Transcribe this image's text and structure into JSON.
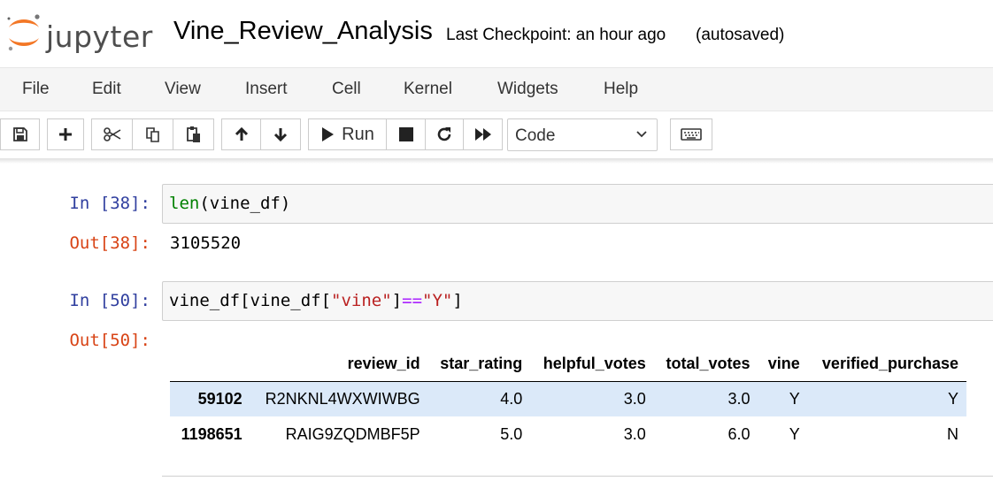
{
  "header": {
    "logo_text": "jupyter",
    "notebook_title": "Vine_Review_Analysis",
    "checkpoint": "Last Checkpoint: an hour ago",
    "autosave": "(autosaved)"
  },
  "menu": [
    "File",
    "Edit",
    "View",
    "Insert",
    "Cell",
    "Kernel",
    "Widgets",
    "Help"
  ],
  "toolbar": {
    "run_label": "Run",
    "cell_type": "Code",
    "icons": [
      "save-icon",
      "plus-icon",
      "cut-icon",
      "copy-icon",
      "paste-icon",
      "arrow-up-icon",
      "arrow-down-icon",
      "run-icon",
      "stop-icon",
      "restart-icon",
      "fast-forward-icon",
      "keyboard-icon"
    ]
  },
  "cells": [
    {
      "in_prompt": "In [38]:",
      "code": {
        "fn": "len",
        "rest": "(vine_df)"
      },
      "out_prompt": "Out[38]:",
      "output": "3105520"
    },
    {
      "in_prompt": "In [50]:",
      "code": {
        "p1": "vine_df[vine_df[",
        "s1": "\"vine\"",
        "p2": "]",
        "op": "==",
        "s2": "\"Y\"",
        "p3": "]"
      },
      "out_prompt": "Out[50]:"
    }
  ],
  "dataframe": {
    "columns": [
      "",
      "review_id",
      "star_rating",
      "helpful_votes",
      "total_votes",
      "vine",
      "verified_purchase"
    ],
    "rows": [
      {
        "index": "59102",
        "values": [
          "R2NKNL4WXWIWBG",
          "4.0",
          "3.0",
          "3.0",
          "Y",
          "Y"
        ]
      },
      {
        "index": "1198651",
        "values": [
          "RAIG9ZQDMBF5P",
          "5.0",
          "3.0",
          "6.0",
          "Y",
          "N"
        ]
      }
    ]
  },
  "colors": {
    "prompt_in": "#303f9f",
    "prompt_out": "#d84315",
    "logo_orange": "#f37726",
    "row_highlight": "#dbe9f9"
  }
}
